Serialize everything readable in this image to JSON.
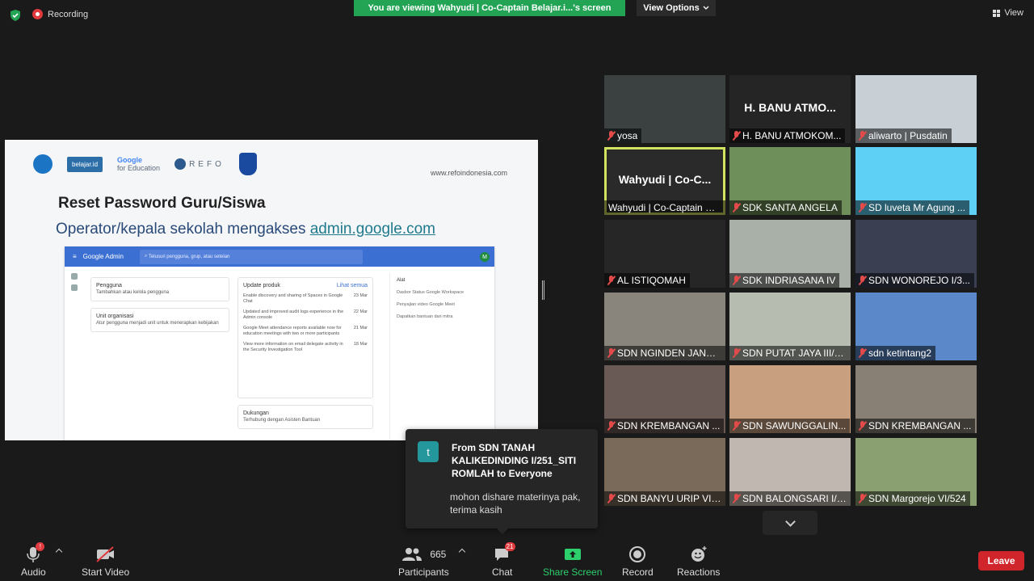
{
  "topbar": {
    "recording_label": "Recording",
    "viewing_banner": "You are viewing Wahyudi | Co-Captain Belajar.i...'s screen",
    "view_options_label": "View Options",
    "view_label": "View",
    "banner_color": "#23a455"
  },
  "slide": {
    "logo_belajar": "belajar.id",
    "logo_google_line1": "Google",
    "logo_google_line2": "for Education",
    "logo_refo": "REFO",
    "url": "www.refoindonesia.com",
    "title": "Reset Password Guru/Siswa",
    "subtitle_prefix": "Operator/kepala sekolah mengakses ",
    "subtitle_link": "admin.google.com",
    "admin": {
      "brand": "Google Admin",
      "search_placeholder": "Telusuri pengguna, grup, atau setelan",
      "avatar": "M",
      "card_users_title": "Pengguna",
      "card_users_desc": "Tambahkan atau kelola pengguna",
      "card_org_title": "Unit organisasi",
      "card_org_desc": "Atur pengguna menjadi unit untuk menerapkan kebijakan",
      "card_updates_title": "Update produk",
      "card_updates_link": "Lihat semua",
      "updates": [
        {
          "text": "Enable discovery and sharing of Spaces in Google Chat",
          "date": "23 Mar"
        },
        {
          "text": "Updated and improved audit logs experience in the Admin console",
          "date": "22 Mar"
        },
        {
          "text": "Google Meet attendance reports available now for education meetings with two or more participants",
          "date": "21 Mar"
        },
        {
          "text": "View more information on email delegate activity in the Security Investigation Tool",
          "date": "18 Mar"
        }
      ],
      "card_support_title": "Dukungan",
      "card_support_desc": "Terhubung dengan Asisten Bantuan",
      "tools_title": "Alat",
      "tools": [
        "Dasbor Status Google Workspace",
        "Penyajian video Google Meet",
        "Dapatkan bantuan dari mitra"
      ]
    }
  },
  "gallery": [
    {
      "big": "",
      "name": "yosa",
      "muted": true
    },
    {
      "big": "H. BANU ATMO...",
      "name": "H. BANU ATMOKOM...",
      "muted": true
    },
    {
      "big": "",
      "name": "aliwarto | Pusdatin",
      "muted": true
    },
    {
      "big": "Wahyudi | Co-C...",
      "name": "Wahyudi | Co-Captain Be...",
      "muted": false,
      "active": true
    },
    {
      "big": "",
      "name": "SDK SANTA ANGELA",
      "muted": true
    },
    {
      "big": "",
      "name": "SD luveta Mr Agung ...",
      "muted": true
    },
    {
      "big": "",
      "name": "AL ISTIQOMAH",
      "muted": true
    },
    {
      "big": "",
      "name": "SDK INDRIASANA IV",
      "muted": true
    },
    {
      "big": "",
      "name": "SDN WONOREJO I/3...",
      "muted": true
    },
    {
      "big": "",
      "name": "SDN NGINDEN JANG...",
      "muted": true
    },
    {
      "big": "",
      "name": "SDN PUTAT JAYA III/3...",
      "muted": true
    },
    {
      "big": "",
      "name": "sdn ketintang2",
      "muted": true
    },
    {
      "big": "",
      "name": "SDN KREMBANGAN ...",
      "muted": true
    },
    {
      "big": "",
      "name": "SDN SAWUNGGALIN...",
      "muted": true
    },
    {
      "big": "",
      "name": "SDN KREMBANGAN ...",
      "muted": true
    },
    {
      "big": "",
      "name": "SDN BANYU URIP VI/...",
      "muted": true
    },
    {
      "big": "",
      "name": "SDN BALONGSARI I/5...",
      "muted": true
    },
    {
      "big": "",
      "name": "SDN Margorejo VI/524",
      "muted": true
    }
  ],
  "chat_popup": {
    "avatar_letter": "t",
    "from": "From SDN TANAH KALIKEDINDING I/251_SITI ROMLAH to Everyone",
    "message": "mohon dishare materinya pak, terima kasih"
  },
  "toolbar": {
    "audio_label": "Audio",
    "audio_badge": "!",
    "video_label": "Start Video",
    "participants_label": "Participants",
    "participants_count": "665",
    "chat_label": "Chat",
    "chat_badge": "21",
    "share_label": "Share Screen",
    "record_label": "Record",
    "reactions_label": "Reactions",
    "leave_label": "Leave"
  }
}
